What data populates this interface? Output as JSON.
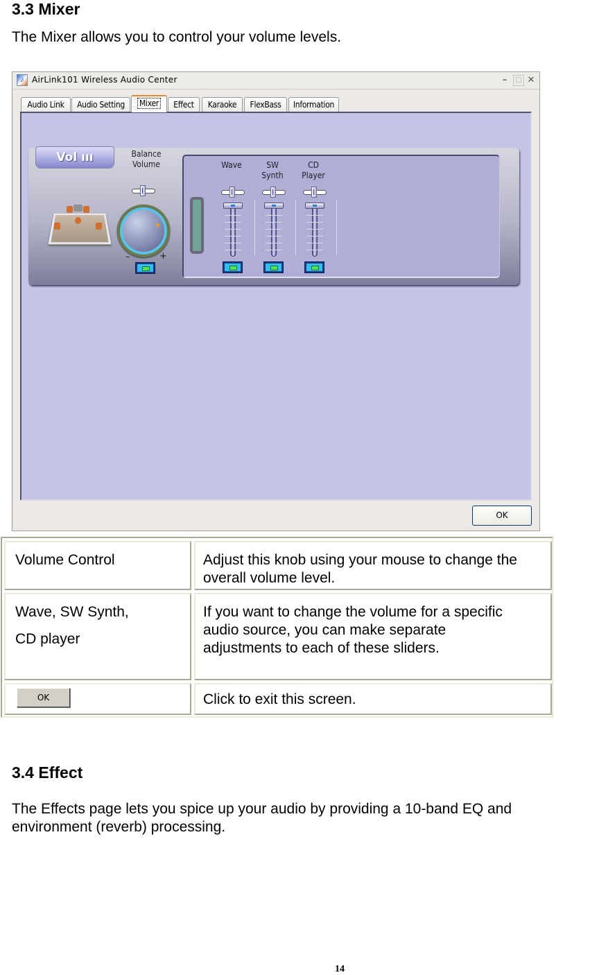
{
  "section_mixer": {
    "heading": "3.3 Mixer",
    "intro": "The Mixer allows you to control your volume levels."
  },
  "window": {
    "title": "AirLink101 Wireless Audio Center",
    "controls": {
      "minimize": "–",
      "maximize": "□",
      "close": "✕"
    },
    "tabs": [
      {
        "label": "Audio Link",
        "active": false
      },
      {
        "label": "Audio Setting",
        "active": false
      },
      {
        "label": "Mixer",
        "active": true
      },
      {
        "label": "Effect",
        "active": false
      },
      {
        "label": "Karaoke",
        "active": false
      },
      {
        "label": "FlexBass",
        "active": false
      },
      {
        "label": "Information",
        "active": false
      }
    ],
    "mixer": {
      "vol_tab_label": "Vol ııı",
      "balance_label_line1": "Balance",
      "balance_label_line2": "Volume",
      "knob_minus": "–",
      "knob_plus": "+",
      "channels": [
        {
          "label_line1": "Wave",
          "label_line2": ""
        },
        {
          "label_line1": "SW",
          "label_line2": "Synth"
        },
        {
          "label_line1": "CD",
          "label_line2": "Player"
        }
      ]
    },
    "ok_label": "OK"
  },
  "table": {
    "rows": [
      {
        "term": "Volume Control",
        "description": "Adjust this knob using your mouse to change the overall volume level."
      },
      {
        "term_line1": "Wave, SW Synth,",
        "term_line2": "CD player",
        "description": "If you want to change the volume for a specific audio source, you can make separate adjustments to each of these sliders."
      },
      {
        "term_button": "OK",
        "description": "Click to exit this screen."
      }
    ]
  },
  "section_effect": {
    "heading": "3.4 Effect",
    "intro": "The Effects page lets you spice up your audio by providing a 10-band EQ and environment (reverb) processing."
  },
  "page_number": "14"
}
